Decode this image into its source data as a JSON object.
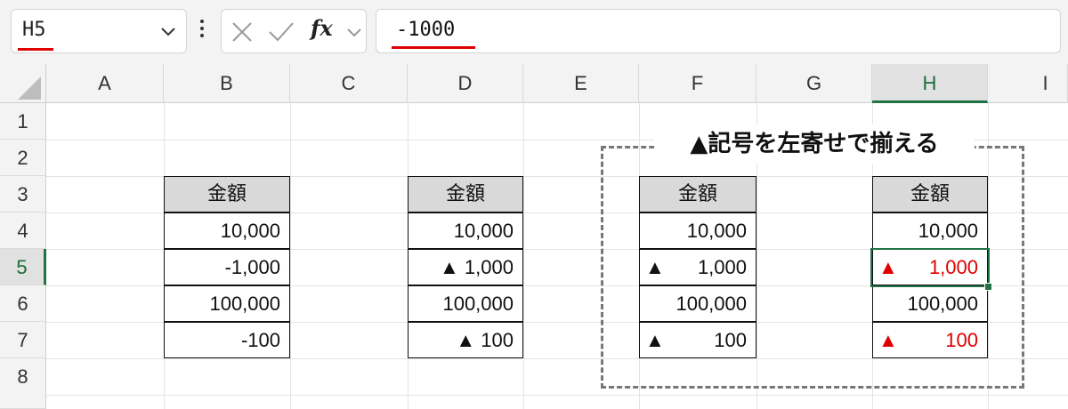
{
  "formula_bar": {
    "name_box": "H5",
    "fx_label": "fx",
    "formula": "-1000"
  },
  "columns": [
    "A",
    "B",
    "C",
    "D",
    "E",
    "F",
    "G",
    "H",
    "I"
  ],
  "rows": [
    "1",
    "2",
    "3",
    "4",
    "5",
    "6",
    "7",
    "8"
  ],
  "selected_cell": "H5",
  "note": "▲記号を左寄せで揃える",
  "tables": {
    "b": {
      "header": "金額",
      "values": [
        "10,000",
        "-1,000",
        "100,000",
        "-100"
      ]
    },
    "d": {
      "header": "金額",
      "values": [
        "10,000",
        "▲ 1,000",
        "100,000",
        "▲ 100"
      ]
    },
    "f": {
      "header": "金額",
      "values": [
        "10,000",
        "1,000",
        "100,000",
        "100"
      ],
      "markers": [
        "",
        "▲",
        "",
        "▲"
      ]
    },
    "h": {
      "header": "金額",
      "values": [
        "10,000",
        "1,000",
        "100,000",
        "100"
      ],
      "markers": [
        "",
        "▲",
        "",
        "▲"
      ]
    }
  },
  "colors": {
    "accent": "#217346",
    "negative": "#e00000",
    "underline": "#e00000"
  }
}
